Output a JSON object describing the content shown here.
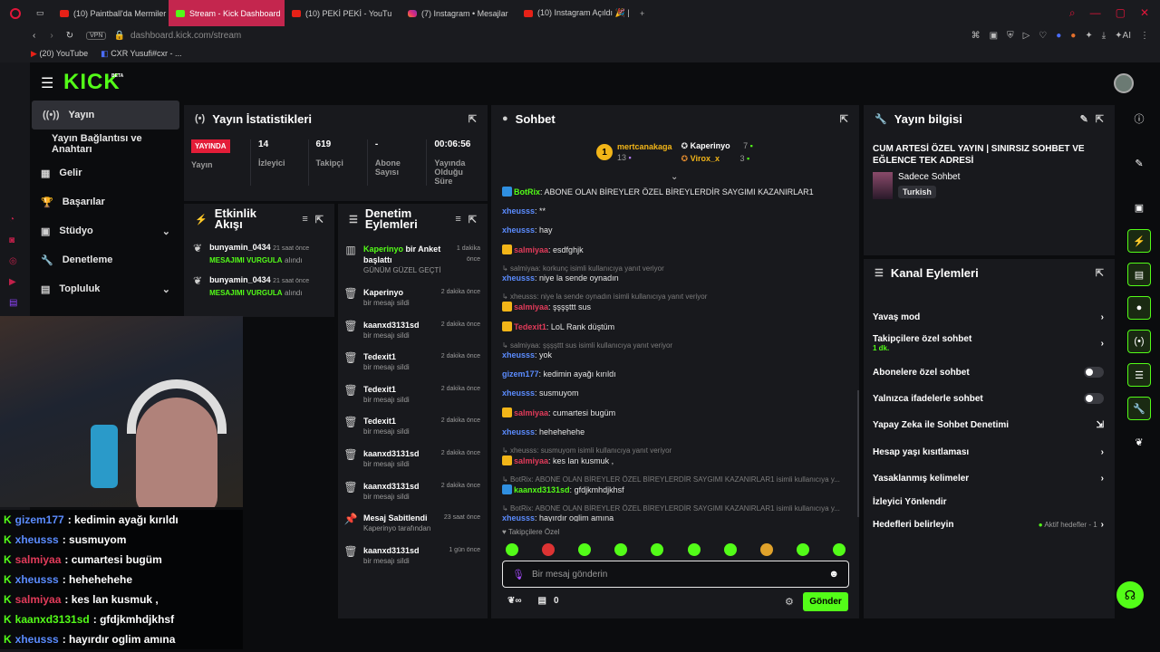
{
  "browser": {
    "tabs": [
      {
        "label": "(10) Paintball'da Mermiler"
      },
      {
        "label": "Stream - Kick Dashboard"
      },
      {
        "label": "(10) PEKİ PEKİ - YouTu"
      },
      {
        "label": "(7) Instagram • Mesajlar"
      },
      {
        "label": "(10) Instagram Açıldı 🎉 | "
      }
    ],
    "url_domain": "dashboard.kick.com",
    "url_path": "/stream",
    "vpn": "VPN",
    "bookmarks": [
      "(20) YouTube",
      "CXR Yusufi#cxr - ..."
    ],
    "ai_label": "AI"
  },
  "nav": {
    "logo": "KICK",
    "beta": "BETA"
  },
  "sidebar": {
    "items": [
      {
        "label": "Yayın"
      },
      {
        "label": "Yayın Bağlantısı ve Anahtarı"
      },
      {
        "label": "Gelir"
      },
      {
        "label": "Başarılar"
      },
      {
        "label": "Stüdyo"
      },
      {
        "label": "Denetleme"
      },
      {
        "label": "Topluluk"
      }
    ]
  },
  "stats": {
    "title": "Yayın İstatistikleri",
    "live_badge": "YAYINDA",
    "live_label": "Yayın",
    "viewers_value": "14",
    "viewers_label": "İzleyici",
    "followers_value": "619",
    "followers_label": "Takipçi",
    "subs_value": "-",
    "subs_label": "Abone Sayısı",
    "duration_value": "00:06:56",
    "duration_label": "Yayında Olduğu Süre"
  },
  "activity": {
    "title": "Etkinlik Akışı",
    "items": [
      {
        "user": "bunyamin_0434",
        "time": "21 saat önce",
        "action": "MESAJIMI VURGULA",
        "suffix": "alındı"
      },
      {
        "user": "bunyamin_0434",
        "time": "21 saat önce",
        "action": "MESAJIMI VURGULA",
        "suffix": "alındı"
      }
    ]
  },
  "moderation": {
    "title": "Denetim Eylemleri",
    "items": [
      {
        "user": "Kaperinyo",
        "rest": " bir Anket başlattı",
        "time": "1 dakika önce",
        "sub": "GÜNÜM GÜZEL GEÇTİ"
      },
      {
        "user": "Kaperinyo",
        "rest": "",
        "time": "2 dakika önce",
        "sub": "bir mesajı sildi"
      },
      {
        "user": "kaanxd3131sd",
        "rest": "",
        "time": "2 dakika önce",
        "sub": "bir mesajı sildi"
      },
      {
        "user": "Tedexit1",
        "rest": "",
        "time": "2 dakika önce",
        "sub": "bir mesajı sildi"
      },
      {
        "user": "Tedexit1",
        "rest": "",
        "time": "2 dakika önce",
        "sub": "bir mesajı sildi"
      },
      {
        "user": "Tedexit1",
        "rest": "",
        "time": "2 dakika önce",
        "sub": "bir mesajı sildi"
      },
      {
        "user": "kaanxd3131sd",
        "rest": "",
        "time": "2 dakika önce",
        "sub": "bir mesajı sildi"
      },
      {
        "user": "kaanxd3131sd",
        "rest": "",
        "time": "2 dakika önce",
        "sub": "bir mesajı sildi"
      },
      {
        "user": "Mesaj Sabitlendi",
        "rest": "",
        "time": "23 saat önce",
        "sub": "Kaperinyo tarafından"
      },
      {
        "user": "kaanxd3131sd",
        "rest": "",
        "time": "1 gün önce",
        "sub": "bir mesajı sildi"
      }
    ]
  },
  "chat": {
    "title": "Sohbet",
    "leaders": {
      "first_name": "mertcanakaga",
      "first_count": "13",
      "second_name": "Kaperinyo",
      "second_count": "7",
      "third_name": "Virox_x",
      "third_count": "3"
    },
    "messages": [
      {
        "reply": "",
        "user": "BotRix",
        "color": "#53fc18",
        "text": "ABONE OLAN BİREYLER ÖZEL BİREYLERDİR SAYGIMI KAZANIRLAR1"
      },
      {
        "reply": "",
        "user": "xheusss",
        "color": "#5b8cff",
        "text": "**"
      },
      {
        "reply": "",
        "user": "xheusss",
        "color": "#5b8cff",
        "text": "hay"
      },
      {
        "reply": "",
        "user": "salmiyaa",
        "color": "#e23b5a",
        "text": "esdfghjk"
      },
      {
        "reply": "salmiyaa: korkunç isimli kullanıcıya yanıt veriyor",
        "user": "xheusss",
        "color": "#5b8cff",
        "text": "niye la sende oynadın"
      },
      {
        "reply": "xheusss: niye la sende oynadın isimli kullanıcıya yanıt veriyor",
        "user": "salmiyaa",
        "color": "#e23b5a",
        "text": "şşşşttt sus"
      },
      {
        "reply": "",
        "user": "Tedexit1",
        "color": "#e23b5a",
        "text": "LoL Rank düştüm"
      },
      {
        "reply": "salmiyaa: şşşşttt sus isimli kullanıcıya yanıt veriyor",
        "user": "xheusss",
        "color": "#5b8cff",
        "text": "yok"
      },
      {
        "reply": "",
        "user": "gizem177",
        "color": "#5b8cff",
        "text": "kedimin ayağı kırıldı"
      },
      {
        "reply": "",
        "user": "xheusss",
        "color": "#5b8cff",
        "text": "susmuyom"
      },
      {
        "reply": "",
        "user": "salmiyaa",
        "color": "#e23b5a",
        "text": "cumartesi bugüm"
      },
      {
        "reply": "",
        "user": "xheusss",
        "color": "#5b8cff",
        "text": "hehehehehe"
      },
      {
        "reply": "xheusss: susmuyom isimli kullanıcıya yanıt veriyor",
        "user": "salmiyaa",
        "color": "#e23b5a",
        "text": "kes lan kusmuk ,"
      },
      {
        "reply": "BotRix: ABONE OLAN BİREYLER ÖZEL BİREYLERDİR SAYGIMI KAZANIRLAR1 isimli kullanıcıya y...",
        "user": "kaanxd3131sd",
        "color": "#53fc18",
        "text": "gfdjkmhdjkhsf"
      },
      {
        "reply": "BotRix: ABONE OLAN BİREYLER ÖZEL BİREYLERDİR SAYGIMI KAZANIRLAR1 isimli kullanıcıya y...",
        "user": "xheusss",
        "color": "#5b8cff",
        "text": "hayırdır oglim amına"
      }
    ],
    "followers_only": "Takipçilere Özel",
    "placeholder": "Bir mesaj gönderin",
    "count": "0",
    "send": "Gönder"
  },
  "stream_info": {
    "title": "Yayın bilgisi",
    "stream_title": "CUM ARTESİ ÖZEL YAYIN | SINIRSIZ SOHBET VE EĞLENCE TEK ADRESİ",
    "category": "Sadece Sohbet",
    "language": "Turkish"
  },
  "channel_actions": {
    "title": "Kanal Eylemleri",
    "slow_mode": "Yavaş mod",
    "followers_chat": "Takipçilere özel sohbet",
    "followers_chat_sub": "1 dk.",
    "subs_chat": "Abonelere özel sohbet",
    "emotes_chat": "Yalnızca ifadelerle sohbet",
    "ai_moderation": "Yapay Zeka ile Sohbet Denetimi",
    "age_restrict": "Hesap yaşı kısıtlaması",
    "banned_words": "Yasaklanmış kelimeler",
    "redirect": "İzleyici Yönlendir",
    "goals": "Hedefleri belirleyin",
    "goals_status": "Aktif hedefler - 1"
  },
  "overlay": {
    "lines": [
      {
        "user": "gizem177",
        "color": "#5b8cff",
        "text": ": kedimin ayağı kırıldı"
      },
      {
        "user": "xheusss",
        "color": "#5b8cff",
        "text": ": susmuyom"
      },
      {
        "user": "salmiyaa",
        "color": "#e23b5a",
        "text": ": cumartesi bugüm"
      },
      {
        "user": "xheusss",
        "color": "#5b8cff",
        "text": ": hehehehehe"
      },
      {
        "user": "salmiyaa",
        "color": "#e23b5a",
        "text": ": kes lan kusmuk ,"
      },
      {
        "user": "kaanxd3131sd",
        "color": "#53fc18",
        "text": ": gfdjkmhdjkhsf"
      },
      {
        "user": "xheusss",
        "color": "#5b8cff",
        "text": ": hayırdır oglim amına"
      }
    ]
  },
  "colors": {
    "accent": "#53fc18",
    "live": "#e31d38",
    "panel": "#18191d",
    "bg": "#0b0c0e"
  }
}
